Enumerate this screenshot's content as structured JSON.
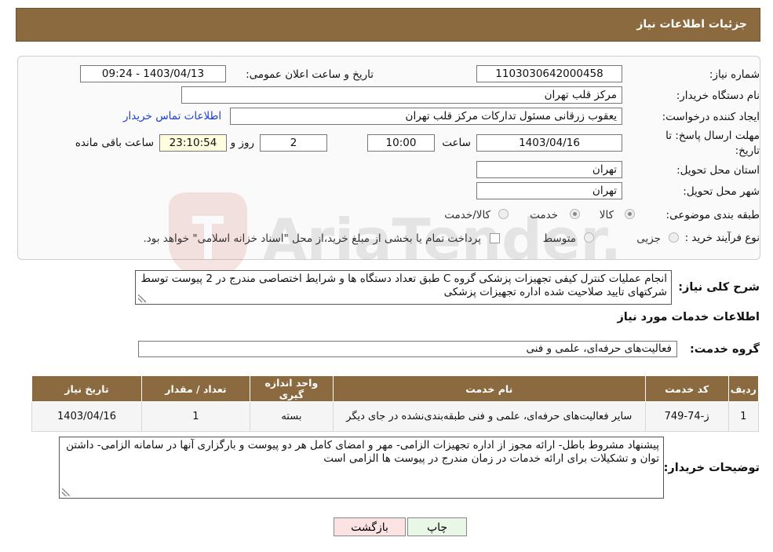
{
  "header": {
    "title": "جزئیات اطلاعات نیاز"
  },
  "form": {
    "need_number_label": "شماره نیاز:",
    "need_number": "1103030642000458",
    "announce_label": "تاریخ و ساعت اعلان عمومی:",
    "announce_value": "1403/04/13 - 09:24",
    "buyer_org_label": "نام دستگاه خریدار:",
    "buyer_org": "مرکز قلب تهران",
    "creator_label": "ایجاد کننده درخواست:",
    "creator": "یعقوب زرقانی مسئول تدارکات مرکز قلب تهران",
    "contact_link": "اطلاعات تماس خریدار",
    "deadline_label_1": "مهلت ارسال پاسخ: تا",
    "deadline_label_2": "تاریخ:",
    "deadline_date": "1403/04/16",
    "time_label": "ساعت",
    "deadline_time": "10:00",
    "days_value": "2",
    "days_label": "روز و",
    "remaining_time": "23:10:54",
    "remaining_label": "ساعت باقی مانده",
    "province_label": "استان محل تحویل:",
    "province": "تهران",
    "city_label": "شهر محل تحویل:",
    "city": "تهران",
    "category_label": "طبقه بندی موضوعی:",
    "category_options": [
      "کالا",
      "خدمت",
      "کالا/خدمت"
    ],
    "process_label": "نوع فرآیند خرید :",
    "process_options": [
      "جزیی",
      "متوسط"
    ],
    "payment_note": "پرداخت تمام یا بخشی از مبلغ خرید،از محل \"اسناد خزانه اسلامی\" خواهد بود."
  },
  "description": {
    "label": "شرح کلی نیاز:",
    "text": "انجام عملیات کنترل کیفی تجهیزات پزشکی گروه C طبق تعداد دستگاه ها و شرایط اختصاصی مندرج در 2 پیوست توسط شرکتهای تایید صلاحیت شده اداره تجهیزات پزشکی"
  },
  "services": {
    "section_title": "اطلاعات خدمات مورد نیاز",
    "group_label": "گروه خدمت:",
    "group_value": "فعالیت‌های حرفه‌ای، علمی و فنی",
    "columns": [
      "ردیف",
      "کد خدمت",
      "نام خدمت",
      "واحد اندازه گیری",
      "تعداد / مقدار",
      "تاریخ نیاز"
    ],
    "rows": [
      {
        "row": "1",
        "code": "ز-74-749",
        "name": "سایر فعالیت‌های حرفه‌ای، علمی و فنی طبقه‌بندی‌نشده در جای دیگر",
        "unit": "بسته",
        "qty": "1",
        "date": "1403/04/16"
      }
    ]
  },
  "buyer_notes": {
    "label": "توضیحات خریدار:",
    "text": "پیشنهاد مشروط باطل- ارائه مجوز از اداره تجهیزات الزامی- مهر و امضای کامل هر دو پیوست و بارگزاری آنها در سامانه الزامی- داشتن توان و تشکیلات برای ارائه خدمات در زمان مندرج در پیوست ها الزامی است"
  },
  "buttons": {
    "print": "چاپ",
    "back": "بازگشت"
  },
  "watermark": {
    "text": "AriaTender.neT"
  },
  "colors": {
    "header": "#8b6a3f",
    "back_button": "#fbe3e3",
    "print_button": "#e8f7e6",
    "link": "#1a3fd6"
  }
}
